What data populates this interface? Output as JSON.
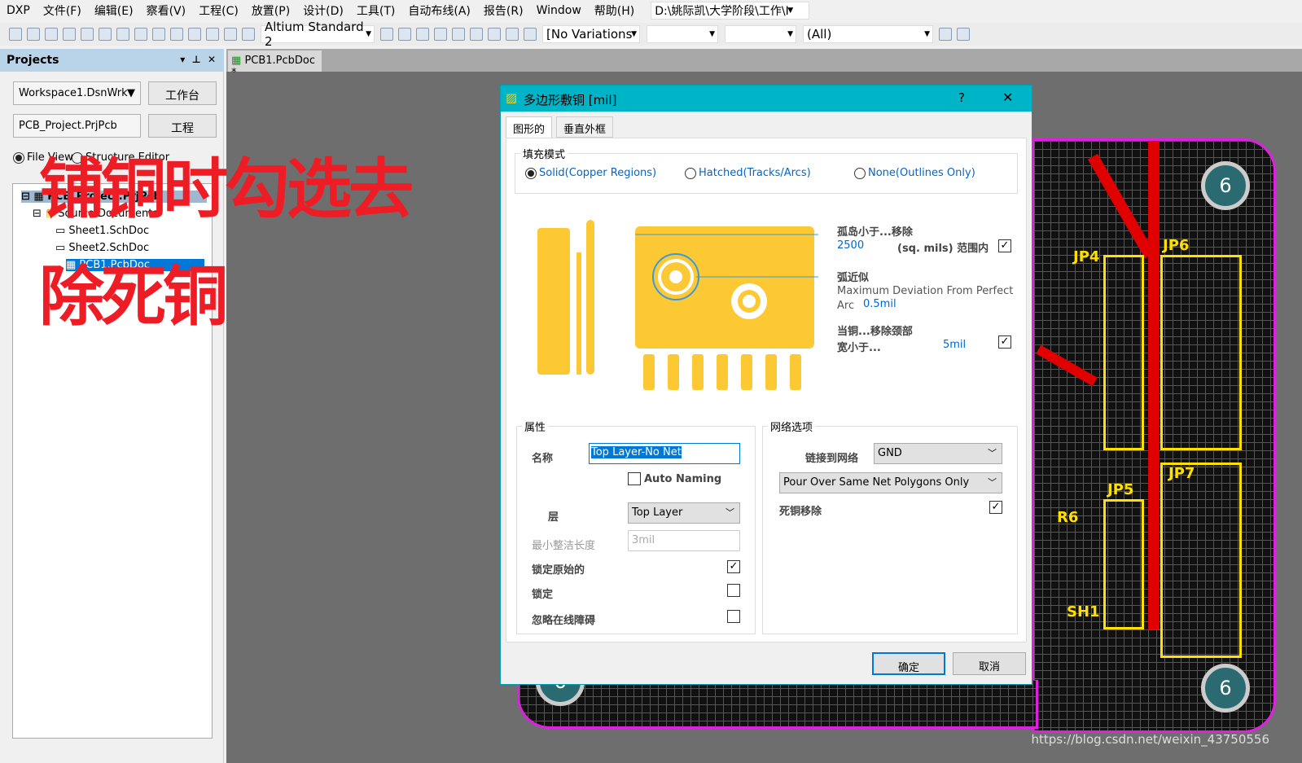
{
  "menu": [
    "DXP",
    "文件(F)",
    "编辑(E)",
    "察看(V)",
    "工程(C)",
    "放置(P)",
    "设计(D)",
    "工具(T)",
    "自动布线(A)",
    "报告(R)",
    "Window",
    "帮助(H)"
  ],
  "path_combo": "D:\\姚际凯\\大学阶段\\工作\\I",
  "toolbar": {
    "style_combo": "Altium Standard 2",
    "variations": "[No Variations",
    "filter": "(All)"
  },
  "panel": {
    "title": "Projects",
    "workspace": "Workspace1.DsnWrk",
    "workspace_btn": "工作台",
    "project": "PCB_Project.PrjPcb",
    "project_btn": "工程",
    "radio_file": "File View",
    "radio_structure": "Structure Editor",
    "tree": [
      "PCB_Project.PrjPcb",
      "Source Documents",
      "Sheet1.SchDoc",
      "Sheet2.SchDoc",
      "PCB1.PcbDoc"
    ]
  },
  "doc_tab": "PCB1.PcbDoc *",
  "overlay": {
    "line1": "铺铜时勾选去",
    "line2": "除死铜"
  },
  "pcb": {
    "labels": [
      "JP6",
      "JP4",
      "JP7",
      "JP5",
      "R6",
      "SH1"
    ],
    "hole_label": "6"
  },
  "dialog": {
    "title": "多边形敷铜 [mil]",
    "help": "?",
    "close": "✕",
    "tabs": [
      "图形的",
      "垂直外框"
    ],
    "fill_mode": {
      "label": "填充模式",
      "options": [
        "Solid(Copper Regions)",
        "Hatched(Tracks/Arcs)",
        "None(Outlines Only)"
      ],
      "selected": 0
    },
    "island": {
      "label": "孤岛小于...移除",
      "value": "2500",
      "unit": "(sq. mils) 范围内",
      "checked": true
    },
    "arc": {
      "label": "弧近似",
      "desc1": "Maximum Deviation From Perfect",
      "desc2": "Arc",
      "value": "0.5mil"
    },
    "neck": {
      "label1": "当铜...移除颈部",
      "label2": "宽小于...",
      "value": "5mil",
      "checked": true
    },
    "props": {
      "label": "属性",
      "name_label": "名称",
      "name_value": "Top Layer-No Net",
      "auto_naming": "Auto Naming",
      "auto_naming_checked": false,
      "layer_label": "层",
      "layer_value": "Top Layer",
      "min_len_label": "最小整洁长度",
      "min_len_value": "3mil",
      "lock_prim": "锁定原始的",
      "lock_prim_checked": true,
      "lock": "锁定",
      "lock_checked": false,
      "ignore": "忽略在线障碍",
      "ignore_checked": false
    },
    "net": {
      "label": "网络选项",
      "connect_label": "链接到网络",
      "connect_value": "GND",
      "pour_value": "Pour Over Same Net Polygons Only",
      "dead_copper": "死铜移除",
      "dead_copper_checked": true
    },
    "ok": "确定",
    "cancel": "取消"
  },
  "watermark": "https://blog.csdn.net/weixin_43750556"
}
